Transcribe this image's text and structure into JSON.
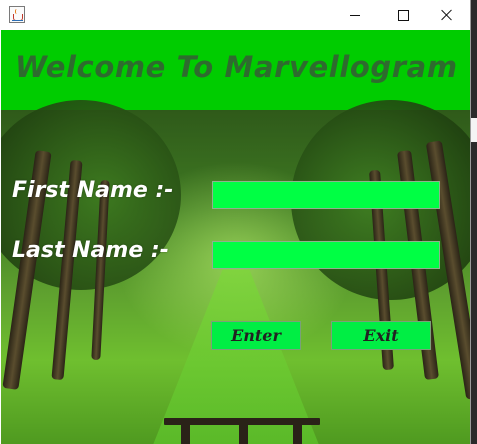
{
  "window": {
    "icon": "java-cup-icon",
    "controls": {
      "minimize": "minimize-icon",
      "maximize": "maximize-icon",
      "close": "close-icon"
    }
  },
  "header": {
    "title": "Welcome To Marvellogram"
  },
  "form": {
    "first_name_label": "First Name :-",
    "last_name_label": "Last Name  :-",
    "first_name_value": "",
    "last_name_value": ""
  },
  "buttons": {
    "enter_label": "Enter",
    "exit_label": "Exit"
  },
  "colors": {
    "header_bg": "#00cc00",
    "field_bg": "#00ff44",
    "button_bg": "#00ee44",
    "title_text": "#2e6b2e"
  }
}
